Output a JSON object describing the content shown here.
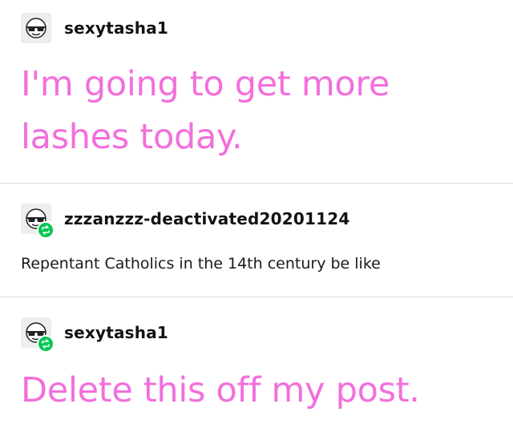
{
  "posts": [
    {
      "username": "sexytasha1",
      "avatar_icon": "sunglasses-emoji-icon",
      "reblog": false,
      "text": "I'm going to get more lashes today.",
      "text_style": "large-pink"
    },
    {
      "username": "zzzanzzz-deactivated20201124",
      "avatar_icon": "sunglasses-emoji-icon",
      "reblog": true,
      "reblog_icon": "reblog-icon",
      "text": "Repentant Catholics in the 14th century be like",
      "text_style": "regular"
    },
    {
      "username": "sexytasha1",
      "avatar_icon": "sunglasses-emoji-icon",
      "reblog": true,
      "reblog_icon": "reblog-icon",
      "text": "Delete this off my post.",
      "text_style": "large-pink"
    }
  ],
  "colors": {
    "pink_text": "#f26fdc",
    "reblog_badge": "#00c853",
    "divider": "#d9d9d9"
  }
}
